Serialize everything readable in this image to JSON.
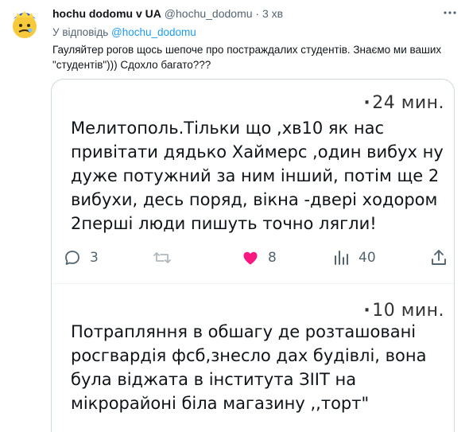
{
  "tweet": {
    "author_name": "hochu dodomu v UA",
    "author_handle": "@hochu_dodomu",
    "dot": "·",
    "time": "3 хв",
    "more_icon": "ellipsis-icon",
    "reply_prefix": "У відповідь ",
    "reply_to": "@hochu_dodomu",
    "text": "Гауляйтер рогов щось шепоче про постраждалих студентів. Знаємо  ми ваших \"студентів\"))) Сдохло багато???"
  },
  "embedded": {
    "post1": {
      "dot": "·",
      "time": "24 мин.",
      "text": "Мелитополь.Тільки що ,хв10 як нас привітати дядько Хаймерс ,один вибух ну дуже потужний за ним інший, потім ще 2 вибухи, десь поряд, вікна -двері ходором 2перші люди пишуть точно лягли!",
      "replies": "3",
      "retweets": "",
      "likes": "8",
      "views": "40"
    },
    "post2": {
      "dot": "·",
      "time": "10 мин.",
      "text": "Потрапляння в обшагу де розташовані росгвардія фсб,знесло дах будівлі, вона була віджата в інститута ЗІІТ на мікрорайоні біла магазину ,,торт\""
    }
  },
  "colors": {
    "like": "#e0245e",
    "link": "#1d9bf0",
    "muted": "#536471"
  }
}
